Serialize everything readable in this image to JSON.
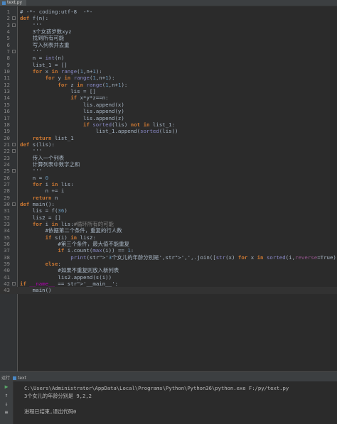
{
  "tab": {
    "name": "text.py"
  },
  "code_lines": [
    {
      "n": "1",
      "t": "# -*- coding:utf-8  -*-",
      "cls": "cmt"
    },
    {
      "n": "2",
      "t": "def f(n):",
      "cls": ""
    },
    {
      "n": "3",
      "t": "    '''",
      "cls": "str"
    },
    {
      "n": "4",
      "t": "    3个女孩岁数xyz",
      "cls": "str"
    },
    {
      "n": "5",
      "t": "    找到所有可能",
      "cls": "str"
    },
    {
      "n": "6",
      "t": "    写入列表并去重",
      "cls": "str"
    },
    {
      "n": "7",
      "t": "    '''",
      "cls": "str"
    },
    {
      "n": "8",
      "t": "    n = int(n)",
      "cls": ""
    },
    {
      "n": "9",
      "t": "    list_1 = []",
      "cls": ""
    },
    {
      "n": "10",
      "t": "    for x in range(1,n+1):",
      "cls": ""
    },
    {
      "n": "11",
      "t": "        for y in range(1,n+1):",
      "cls": ""
    },
    {
      "n": "12",
      "t": "            for z in range(1,n+1):",
      "cls": ""
    },
    {
      "n": "13",
      "t": "                lis = []",
      "cls": ""
    },
    {
      "n": "14",
      "t": "                if x*y*z==n:",
      "cls": ""
    },
    {
      "n": "15",
      "t": "                    lis.append(x)",
      "cls": ""
    },
    {
      "n": "16",
      "t": "                    lis.append(y)",
      "cls": ""
    },
    {
      "n": "17",
      "t": "                    lis.append(z)",
      "cls": ""
    },
    {
      "n": "18",
      "t": "                    if sorted(lis) not in list_1:",
      "cls": ""
    },
    {
      "n": "19",
      "t": "                        list_1.append(sorted(lis))",
      "cls": ""
    },
    {
      "n": "20",
      "t": "    return list_1",
      "cls": ""
    },
    {
      "n": "21",
      "t": "def s(lis):",
      "cls": ""
    },
    {
      "n": "22",
      "t": "    '''",
      "cls": "str"
    },
    {
      "n": "23",
      "t": "    传入一个列表",
      "cls": "str"
    },
    {
      "n": "24",
      "t": "    计算列表中数字之和",
      "cls": "str"
    },
    {
      "n": "25",
      "t": "    '''",
      "cls": "str"
    },
    {
      "n": "26",
      "t": "    n = 0",
      "cls": ""
    },
    {
      "n": "27",
      "t": "    for i in lis:",
      "cls": ""
    },
    {
      "n": "28",
      "t": "        n += i",
      "cls": ""
    },
    {
      "n": "29",
      "t": "    return n",
      "cls": ""
    },
    {
      "n": "30",
      "t": "def main():",
      "cls": ""
    },
    {
      "n": "31",
      "t": "    lis = f(36)",
      "cls": ""
    },
    {
      "n": "32",
      "t": "    lis2 = []",
      "cls": ""
    },
    {
      "n": "33",
      "t": "    for i in lis:#循环所有的可能",
      "cls": ""
    },
    {
      "n": "34",
      "t": "        #依据第二个条件，重复的行人数",
      "cls": "cmt"
    },
    {
      "n": "35",
      "t": "        if s(i) in lis2:",
      "cls": ""
    },
    {
      "n": "36",
      "t": "            #第三个条件，最大值不能重复",
      "cls": "cmt"
    },
    {
      "n": "37",
      "t": "            if i.count(max(i)) == 1:",
      "cls": ""
    },
    {
      "n": "38",
      "t": "                print('3个女儿的年龄分别是',',',.join([str(x) for x in sorted(i,reverse=True)]))",
      "cls": ""
    },
    {
      "n": "39",
      "t": "        else:",
      "cls": ""
    },
    {
      "n": "40",
      "t": "            #如果不重复则放入新列表",
      "cls": "cmt"
    },
    {
      "n": "41",
      "t": "            lis2.append(s(i))",
      "cls": ""
    },
    {
      "n": "42",
      "t": "if __name__ == '__main__':",
      "cls": ""
    },
    {
      "n": "43",
      "t": "    main()",
      "cls": ""
    }
  ],
  "run_panel": {
    "label": "运行",
    "config_name": "text"
  },
  "console": {
    "command": "C:\\Users\\Administrator\\AppData\\Local\\Programs\\Python\\Python36\\python.exe F:/py/text.py",
    "output": "3个女儿的年龄分别是 9,2,2",
    "exit": "进程已结束,退出代码0"
  },
  "colors": {
    "editor_bg": "#2b2b2b",
    "keyword": "#cc7832",
    "function": "#ffc66d",
    "string": "#6a8759",
    "comment": "#808080",
    "number": "#6897bb"
  },
  "icons": [
    "python-file-icon",
    "rerun-icon",
    "scroll-up-icon",
    "scroll-down-icon",
    "soft-wrap-icon"
  ]
}
